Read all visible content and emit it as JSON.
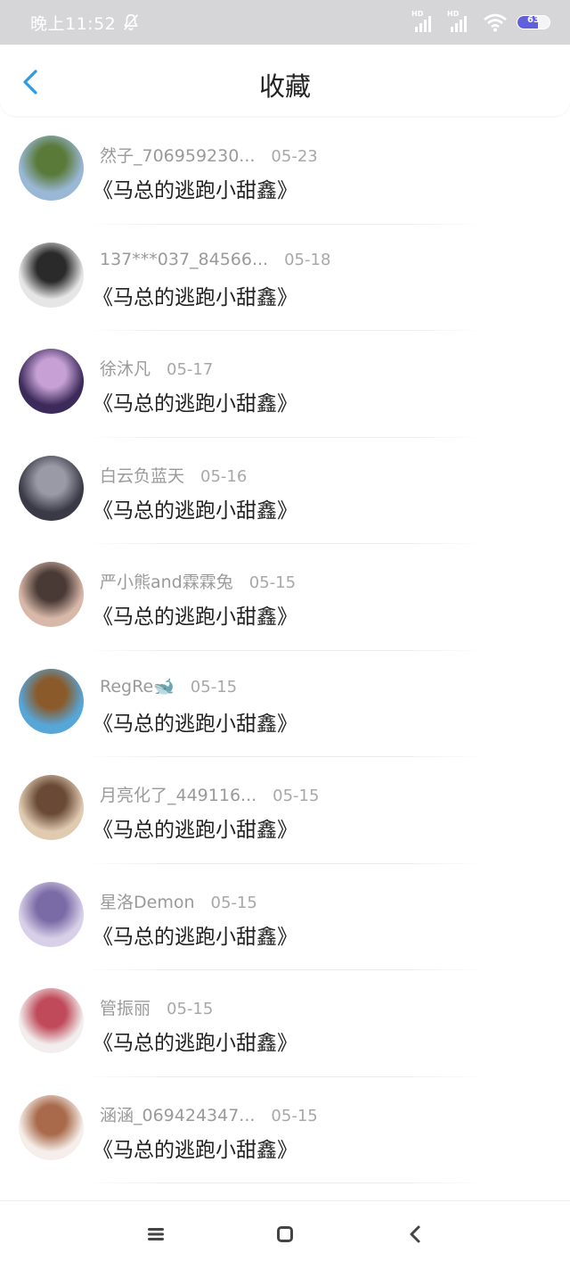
{
  "status_bar": {
    "time": "晚上11:52",
    "battery": "63",
    "battery_level": 0.63,
    "signal_labels": [
      "HD",
      "HD"
    ]
  },
  "header": {
    "title": "收藏"
  },
  "favorites": [
    {
      "name": "然子_706959230...",
      "date": "05-23",
      "book": "《马总的逃跑小甜鑫》",
      "avatar_colors": [
        "#9ab8d6",
        "#5a7a3a"
      ]
    },
    {
      "name": "137***037_84566...",
      "date": "05-18",
      "book": "《马总的逃跑小甜鑫》",
      "avatar_colors": [
        "#e6e6e6",
        "#2a2a2a"
      ]
    },
    {
      "name": "徐沐凡",
      "date": "05-17",
      "book": "《马总的逃跑小甜鑫》",
      "avatar_colors": [
        "#3b2a5a",
        "#c7a1d6"
      ]
    },
    {
      "name": "白云负蓝天",
      "date": "05-16",
      "book": "《马总的逃跑小甜鑫》",
      "avatar_colors": [
        "#3a3a46",
        "#9a9aa6"
      ]
    },
    {
      "name": "严小熊and霖霖兔",
      "date": "05-15",
      "book": "《马总的逃跑小甜鑫》",
      "avatar_colors": [
        "#d8b8a8",
        "#4a3a36"
      ]
    },
    {
      "name": "RegRe🐋",
      "date": "05-15",
      "book": "《马总的逃跑小甜鑫》",
      "avatar_colors": [
        "#57a6d8",
        "#8a5a2a"
      ]
    },
    {
      "name": "月亮化了_449116...",
      "date": "05-15",
      "book": "《马总的逃跑小甜鑫》",
      "avatar_colors": [
        "#e0cab0",
        "#6a4a36"
      ]
    },
    {
      "name": "星洛Demon",
      "date": "05-15",
      "book": "《马总的逃跑小甜鑫》",
      "avatar_colors": [
        "#d8d0e8",
        "#7a6aa6"
      ]
    },
    {
      "name": "管振丽",
      "date": "05-15",
      "book": "《马总的逃跑小甜鑫》",
      "avatar_colors": [
        "#f2eeee",
        "#c04a5a"
      ]
    },
    {
      "name": "涵涵_069424347...",
      "date": "05-15",
      "book": "《马总的逃跑小甜鑫》",
      "avatar_colors": [
        "#f6eeea",
        "#a86a4a"
      ]
    }
  ],
  "nav_bar": {
    "icons": [
      "menu-icon",
      "home-icon",
      "back-icon"
    ]
  },
  "colors": {
    "accent": "#2b9be8",
    "status_bar_bg": "#d6d6d8",
    "title": "#222222",
    "secondary_text": "#9a9a9a"
  }
}
